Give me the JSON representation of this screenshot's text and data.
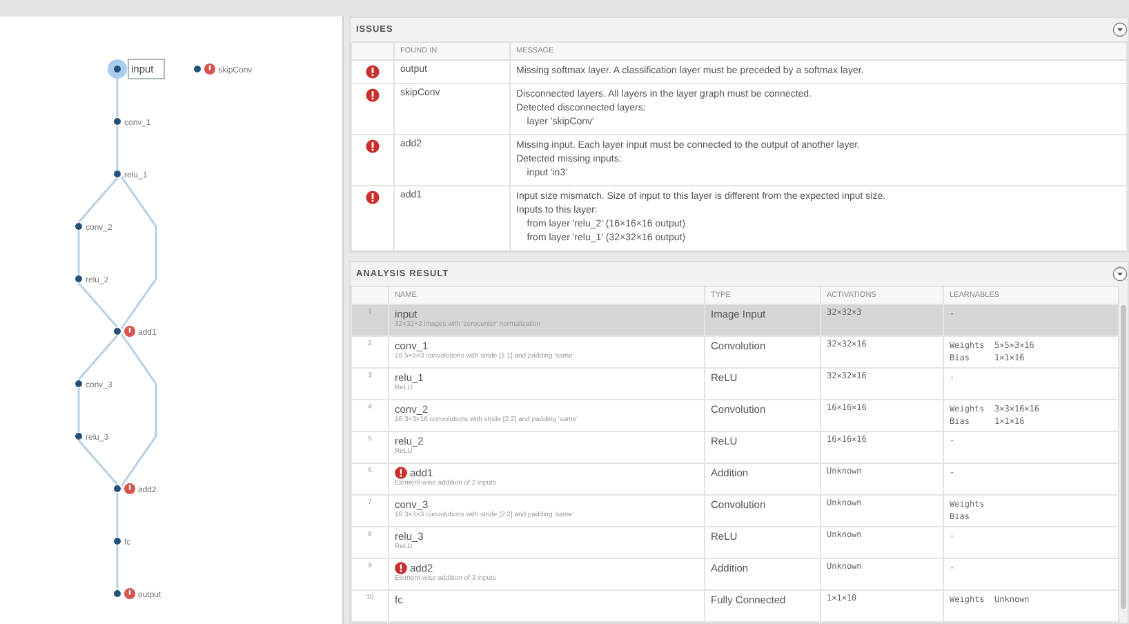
{
  "graph": {
    "nodes": [
      {
        "label": "input",
        "error": false,
        "selected": true
      },
      {
        "label": "conv_1",
        "error": false,
        "selected": false
      },
      {
        "label": "relu_1",
        "error": false,
        "selected": false
      },
      {
        "label": "conv_2",
        "error": false,
        "selected": false
      },
      {
        "label": "relu_2",
        "error": false,
        "selected": false
      },
      {
        "label": "add1",
        "error": true,
        "selected": false
      },
      {
        "label": "conv_3",
        "error": false,
        "selected": false
      },
      {
        "label": "relu_3",
        "error": false,
        "selected": false
      },
      {
        "label": "add2",
        "error": true,
        "selected": false
      },
      {
        "label": "fc",
        "error": false,
        "selected": false
      },
      {
        "label": "output",
        "error": true,
        "selected": false
      }
    ],
    "disconnected": [
      {
        "label": "skipConv",
        "error": true,
        "selected": false
      }
    ]
  },
  "issues": {
    "title": "ISSUES",
    "columns": [
      "FOUND IN",
      "MESSAGE"
    ],
    "rows": [
      {
        "found_in": "output",
        "message": [
          "Missing softmax layer. A classification layer must be preceded by a softmax layer."
        ]
      },
      {
        "found_in": "skipConv",
        "message": [
          "Disconnected layers. All layers in the layer graph must be connected.",
          "Detected disconnected layers:",
          "    layer 'skipConv'"
        ]
      },
      {
        "found_in": "add2",
        "message": [
          "Missing input. Each layer input must be connected to the output of another layer.",
          "Detected missing inputs:",
          "    input 'in3'"
        ]
      },
      {
        "found_in": "add1",
        "message": [
          "Input size mismatch. Size of input to this layer is different from the expected input size.",
          "Inputs to this layer:",
          "    from layer 'relu_2' (16×16×16 output)",
          "    from layer 'relu_1' (32×32×16 output)"
        ]
      }
    ]
  },
  "analysis": {
    "title": "ANALYSIS RESULT",
    "columns": [
      "NAME",
      "TYPE",
      "ACTIVATIONS",
      "LEARNABLES"
    ],
    "rows": [
      {
        "index": "1",
        "name": "input",
        "description": "32×32×3 images with 'zerocenter' normalization",
        "type": "Image Input",
        "activations": "32×32×3",
        "learnables": [
          "-"
        ],
        "error": false,
        "selected": true
      },
      {
        "index": "2",
        "name": "conv_1",
        "description": "16 5×5×3 convolutions with stride [1 1] and padding 'same'",
        "type": "Convolution",
        "activations": "32×32×16",
        "learnables": [
          "Weights  5×5×3×16",
          "Bias     1×1×16"
        ],
        "error": false,
        "selected": false
      },
      {
        "index": "3",
        "name": "relu_1",
        "description": "ReLU",
        "type": "ReLU",
        "activations": "32×32×16",
        "learnables": [
          "-"
        ],
        "error": false,
        "selected": false
      },
      {
        "index": "4",
        "name": "conv_2",
        "description": "16 3×3×16 convolutions with stride [2 2] and padding 'same'",
        "type": "Convolution",
        "activations": "16×16×16",
        "learnables": [
          "Weights  3×3×16×16",
          "Bias     1×1×16"
        ],
        "error": false,
        "selected": false
      },
      {
        "index": "5",
        "name": "relu_2",
        "description": "ReLU",
        "type": "ReLU",
        "activations": "16×16×16",
        "learnables": [
          "-"
        ],
        "error": false,
        "selected": false
      },
      {
        "index": "6",
        "name": "add1",
        "description": "Element-wise addition of 2 inputs",
        "type": "Addition",
        "activations": "Unknown",
        "learnables": [
          "-"
        ],
        "error": true,
        "selected": false
      },
      {
        "index": "7",
        "name": "conv_3",
        "description": "16 3×3×3 convolutions with stride [2 2] and padding 'same'",
        "type": "Convolution",
        "activations": "Unknown",
        "learnables": [
          "Weights",
          "Bias"
        ],
        "error": false,
        "selected": false
      },
      {
        "index": "8",
        "name": "relu_3",
        "description": "ReLU",
        "type": "ReLU",
        "activations": "Unknown",
        "learnables": [
          "-"
        ],
        "error": false,
        "selected": false
      },
      {
        "index": "9",
        "name": "add2",
        "description": "Element-wise addition of 3 inputs",
        "type": "Addition",
        "activations": "Unknown",
        "learnables": [
          "-"
        ],
        "error": true,
        "selected": false
      },
      {
        "index": "10",
        "name": "fc",
        "type": "Fully Connected",
        "activations": "1×1×10",
        "learnables": [
          "Weights  Unknown"
        ],
        "error": false,
        "selected": false
      }
    ]
  }
}
